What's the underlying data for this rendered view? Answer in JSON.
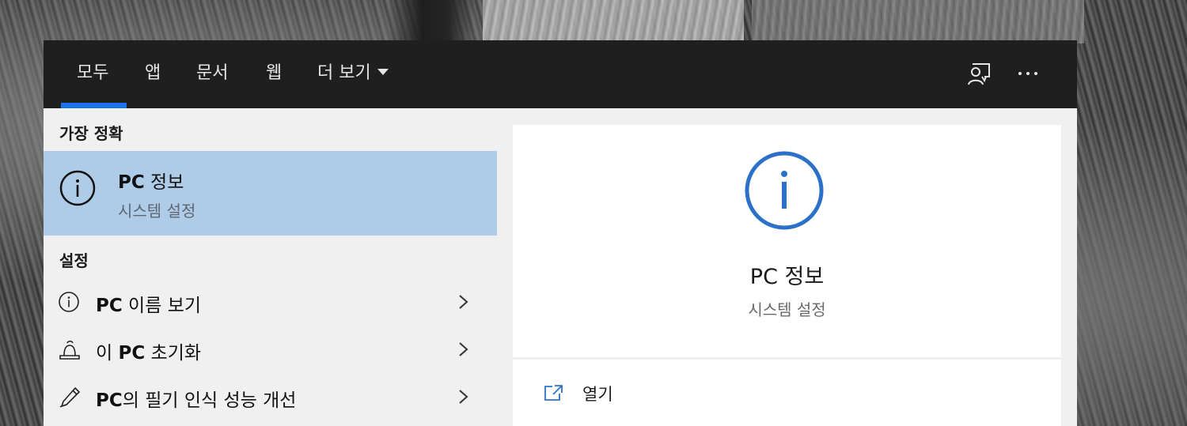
{
  "tabs": [
    {
      "label": "모두",
      "active": true
    },
    {
      "label": "앱"
    },
    {
      "label": "문서"
    },
    {
      "label": "웹"
    },
    {
      "label": "더 보기"
    }
  ],
  "topbar": {
    "feedback_icon": "feedback-person-icon",
    "more_icon": "more-options-icon"
  },
  "best_match": {
    "heading": "가장 정확",
    "title_bold": "PC",
    "title_rest": " 정보",
    "subtitle": "시스템 설정",
    "icon": "info-circle-icon"
  },
  "settings": {
    "heading": "설정",
    "items": [
      {
        "icon": "info-circle-icon",
        "bold": "PC",
        "pre": "",
        "post": " 이름 보기"
      },
      {
        "icon": "reset-pc-icon",
        "pre": "이 ",
        "bold": "PC",
        "post": " 초기화"
      },
      {
        "icon": "pen-icon",
        "pre": "",
        "bold": "PC",
        "post": "의 필기 인식 성능 개선"
      }
    ]
  },
  "preview": {
    "title": "PC 정보",
    "subtitle": "시스템 설정",
    "icon": "info-circle-icon",
    "actions": [
      {
        "label": "열기",
        "icon": "open-icon"
      }
    ]
  },
  "colors": {
    "accent": "#1a73e8",
    "selection": "#aecbe8",
    "topbar": "#1f1f1f",
    "info_blue": "#2b71c9"
  }
}
